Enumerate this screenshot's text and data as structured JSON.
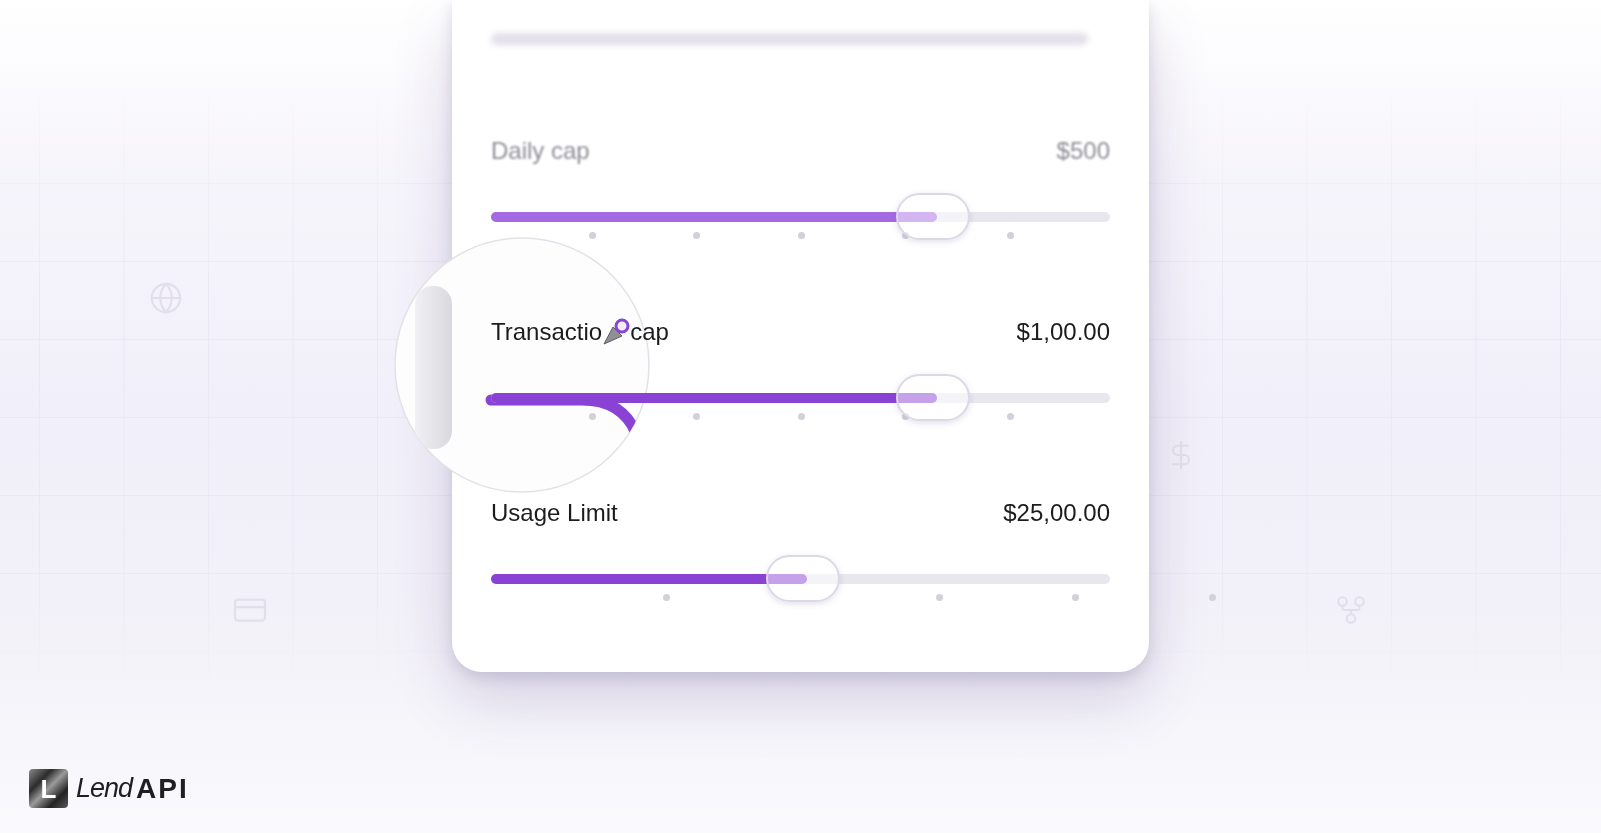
{
  "card": {
    "sliders": [
      {
        "kind": "plain",
        "label": "Daily cap",
        "value": "$500",
        "level": 0.72,
        "faded": true
      },
      {
        "kind": "cursor",
        "label_before": "Transactio",
        "label_after": "cap",
        "value": "$1,00.00",
        "level": 0.72,
        "faded": false
      },
      {
        "kind": "plain",
        "label": "Usage Limit",
        "value": "$25,00.00",
        "level": 0.51,
        "faded": false
      }
    ]
  },
  "logo": {
    "mark": "L",
    "light": "Lend",
    "bold": "API"
  }
}
